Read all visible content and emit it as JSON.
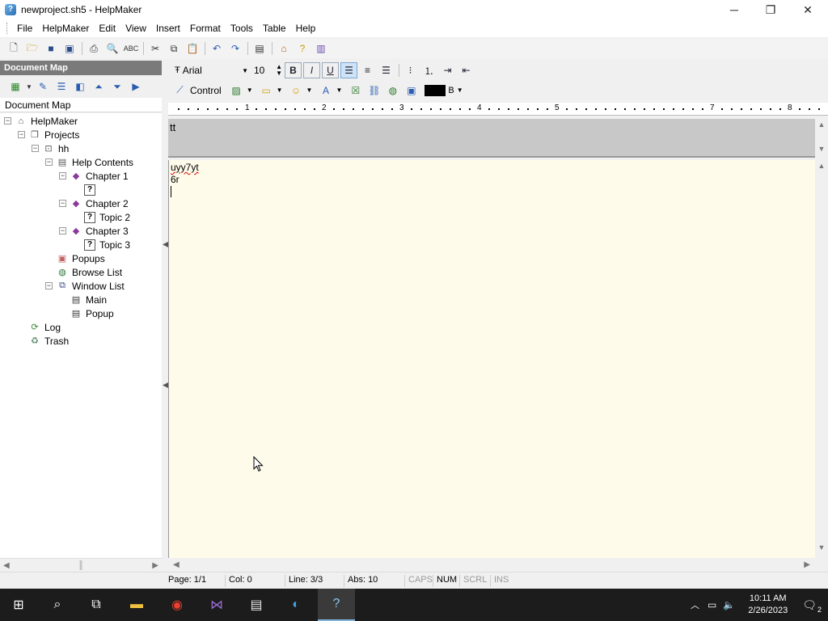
{
  "window": {
    "title": "newproject.sh5 - HelpMaker",
    "minimize": "─",
    "restore": "❐",
    "close": "✕"
  },
  "menu": [
    "File",
    "HelpMaker",
    "Edit",
    "View",
    "Insert",
    "Format",
    "Tools",
    "Table",
    "Help"
  ],
  "document_map": {
    "header": "Document Map",
    "label": "Document Map"
  },
  "tree": [
    {
      "label": "HelpMaker",
      "icon": "home-icon",
      "level": 0,
      "expander": "−"
    },
    {
      "label": "Projects",
      "icon": "projects-icon",
      "level": 1,
      "expander": "−"
    },
    {
      "label": "hh",
      "icon": "project-icon",
      "level": 2,
      "expander": "−"
    },
    {
      "label": "Help Contents",
      "icon": "contents-icon",
      "level": 3,
      "expander": "−"
    },
    {
      "label": "Chapter 1",
      "icon": "book-icon",
      "level": 4,
      "expander": "−"
    },
    {
      "label": "",
      "icon": "topic-icon",
      "level": 5,
      "expander": ""
    },
    {
      "label": "Chapter 2",
      "icon": "book-icon",
      "level": 4,
      "expander": "−"
    },
    {
      "label": "Topic 2",
      "icon": "topic-icon",
      "level": 5,
      "expander": ""
    },
    {
      "label": "Chapter 3",
      "icon": "book-icon",
      "level": 4,
      "expander": "−"
    },
    {
      "label": "Topic 3",
      "icon": "topic-icon",
      "level": 5,
      "expander": ""
    },
    {
      "label": "Popups",
      "icon": "popups-icon",
      "level": 3,
      "expander": ""
    },
    {
      "label": "Browse List",
      "icon": "browse-icon",
      "level": 3,
      "expander": ""
    },
    {
      "label": "Window List",
      "icon": "windows-icon",
      "level": 3,
      "expander": "−"
    },
    {
      "label": "Main",
      "icon": "window-icon",
      "level": 4,
      "expander": ""
    },
    {
      "label": "Popup",
      "icon": "window-icon",
      "level": 4,
      "expander": ""
    },
    {
      "label": "Log",
      "icon": "log-icon",
      "level": 1,
      "expander": ""
    },
    {
      "label": "Trash",
      "icon": "trash-icon",
      "level": 1,
      "expander": ""
    }
  ],
  "format": {
    "font": "Arial",
    "size": "10",
    "control_label": "Control",
    "color_label": "B",
    "text_color": "#000000"
  },
  "ruler": [
    "1",
    "2",
    "3",
    "4",
    "5",
    "7",
    "8"
  ],
  "header_text": "tt",
  "editor": {
    "line1": "uyy7yt",
    "line2": "6r"
  },
  "status": {
    "page": "Page: 1/1",
    "col": "Col: 0",
    "line": "Line: 3/3",
    "abs": "Abs: 10",
    "caps": "CAPS",
    "num": "NUM",
    "scrl": "SCRL",
    "ins": "INS"
  },
  "taskbar": {
    "time": "10:11 AM",
    "date": "2/26/2023",
    "notification_count": "2"
  },
  "colors": {
    "editor_bg": "#fffbeb",
    "docmap_header_bg": "#7a7a7a",
    "taskbar_bg": "#1c1c1c"
  }
}
